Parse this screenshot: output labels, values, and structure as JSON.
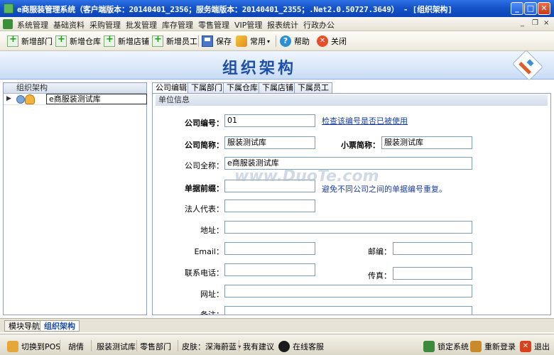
{
  "window": {
    "title": "e商服装管理系统（客户端版本：20140401_2356；服务端版本：20140401_2355；.Net2.0.50727.3649） - [组织架构]",
    "controls": {
      "minimize": "_",
      "maximize": "□",
      "close": "✕"
    }
  },
  "menu": {
    "items": [
      "系统管理",
      "基础资料",
      "采购管理",
      "批发管理",
      "库存管理",
      "零售管理",
      "VIP管理",
      "报表统计",
      "行政办公"
    ],
    "mdi_controls": {
      "minimize": "_",
      "restore": "❐",
      "close": "×"
    }
  },
  "toolbar": {
    "add_dept": "新增部门",
    "add_warehouse": "新增仓库",
    "add_store": "新增店铺",
    "add_staff": "新增员工",
    "save": "保存",
    "common": "常用",
    "common_caret": "▾",
    "help": "帮助",
    "close": "关闭"
  },
  "banner": {
    "title": "组织架构"
  },
  "left_panel": {
    "header": "组织架构",
    "tree": [
      {
        "arrow": "▶",
        "label": "e商服装测试库"
      }
    ]
  },
  "tabs": [
    "公司编辑",
    "下属部门",
    "下属仓库",
    "下属店铺",
    "下属员工"
  ],
  "form": {
    "section_title": "单位信息",
    "company_code_label": "公司编号：",
    "company_code_value": "01",
    "check_code_link": "检查该编号是否已被使用",
    "short_name_label": "公司简称：",
    "short_name_value": "服装测试库",
    "ticket_name_label": "小票简称：",
    "ticket_name_value": "服装测试库",
    "full_name_label": "公司全称：",
    "full_name_value": "e商服装测试库",
    "prefix_label": "单据前缀：",
    "prefix_value": "",
    "prefix_hint": "避免不同公司之间的单据编号重复。",
    "legal_rep_label": "法人代表：",
    "legal_rep_value": "",
    "address_label": "地址：",
    "address_value": "",
    "email_label": "Email：",
    "email_value": "",
    "postcode_label": "邮编：",
    "postcode_value": "",
    "phone_label": "联系电话：",
    "phone_value": "",
    "fax_label": "传真：",
    "fax_value": "",
    "website_label": "网址：",
    "website_value": "",
    "remark_label": "备注：",
    "remark_value": ""
  },
  "watermark": "www.DuoTe.com",
  "bottom_tabs": [
    "模块导航",
    "组织架构"
  ],
  "status": {
    "switch_pos": "切换到POS",
    "user": "胡倩",
    "company": "服装测试库",
    "dept": "零售部门",
    "skin": "皮肤：深海蔚蓝",
    "skin_caret": "▾",
    "suggest": "我有建议",
    "online_service": "在线客服",
    "lock": "锁定系统",
    "relogin": "重新登录",
    "exit": "退出"
  }
}
